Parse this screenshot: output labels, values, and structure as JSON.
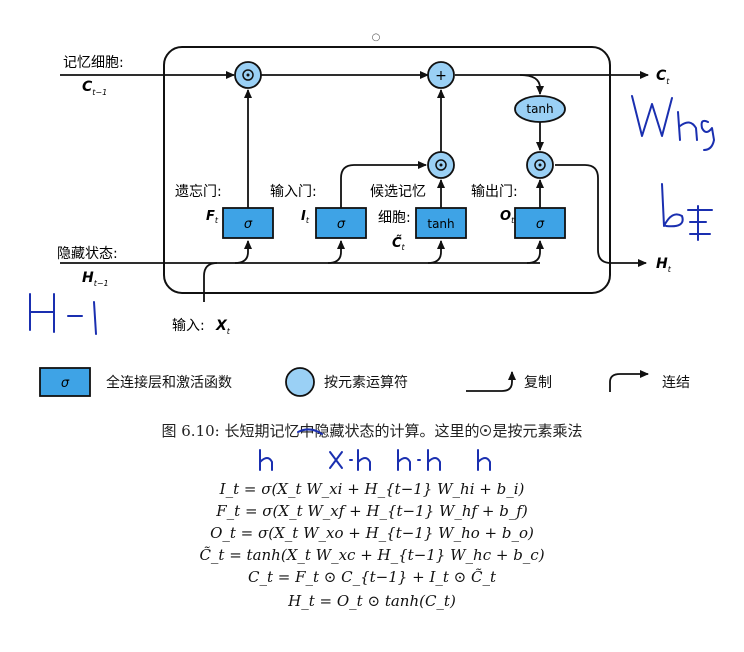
{
  "diagram": {
    "memory_cell_label": "记忆细胞:",
    "c_prev": "C",
    "c_prev_sub": "t−1",
    "hidden_state_label": "隐藏状态:",
    "h_prev": "H",
    "h_prev_sub": "t−1",
    "input_label": "输入:",
    "x_t": "X",
    "x_t_sub": "t",
    "c_out": "C",
    "c_out_sub": "t",
    "h_out": "H",
    "h_out_sub": "t",
    "forget_gate_label": "遗忘门:",
    "forget_symbol": "F",
    "forget_sub": "t",
    "input_gate_label": "输入门:",
    "input_symbol": "I",
    "input_sub": "t",
    "candidate_label_line1": "候选记忆",
    "candidate_label_line2": "细胞:",
    "candidate_symbol": "C̃",
    "candidate_sub": "t",
    "output_gate_label": "输出门:",
    "output_symbol": "O",
    "output_sub": "t",
    "sigma": "σ",
    "tanh": "tanh",
    "plus": "+",
    "top_mark": "○"
  },
  "legend": {
    "sigma": "σ",
    "fc_label": "全连接层和激活函数",
    "elementwise_label": "按元素运算符",
    "copy_label": "复制",
    "concat_label": "连结"
  },
  "caption": {
    "text_before": "图 6.10: 长短期记忆中隐藏状态的计算。这里的",
    "text_after": "是按元素乘法"
  },
  "equations": [
    "I_t = σ(X_t W_xi + H_{t−1} W_hi + b_i)",
    "F_t = σ(X_t W_xf + H_{t−1} W_hf + b_f)",
    "O_t = σ(X_t W_xo + H_{t−1} W_ho + b_o)",
    "C̃_t = tanh(X_t W_xc + H_{t−1} W_hc + b_c)",
    "C_t = F_t ⊙ C_{t−1} + I_t ⊙ C̃_t",
    "H_t = O_t ⊙ tanh(C_t)"
  ],
  "colors": {
    "gate_fill": "#3ea3e6",
    "op_fill": "#9ad0f5",
    "tanh_fill": "#9ad0f5",
    "ink": "#1a2fb0"
  }
}
